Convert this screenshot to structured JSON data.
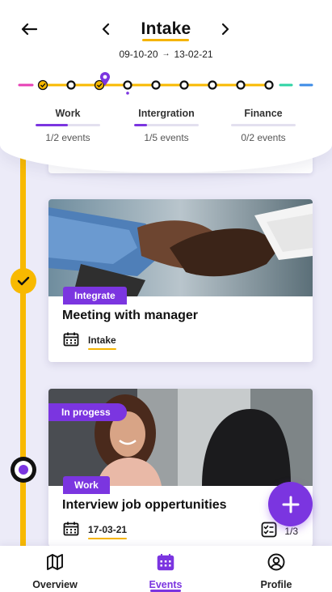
{
  "header": {
    "title": "Intake",
    "date_start": "09-10-20",
    "date_arrow": "→",
    "date_end": "13-02-21"
  },
  "stats": [
    {
      "label": "Work",
      "count": "1/2 events",
      "progress": 0.5
    },
    {
      "label": "Intergration",
      "count": "1/5 events",
      "progress": 0.2
    },
    {
      "label": "Finance",
      "count": "0/2 events",
      "progress": 0
    }
  ],
  "colors": {
    "accent": "#7b35e0",
    "rail": "#f8b900",
    "pink": "#e63fb5",
    "teal": "#2ed3a4",
    "blue": "#3c8be6"
  },
  "cards": [
    {
      "category": "Integrate",
      "title": "Meeting with manager",
      "meta": "Intake",
      "meta_icon": "calendar-icon"
    },
    {
      "status": "In progess",
      "category": "Work",
      "title": "Interview job oppertunities",
      "meta": "17-03-21",
      "meta_icon": "calendar-icon",
      "tasks": "1/3",
      "tasks_icon": "checklist-icon"
    }
  ],
  "nav": {
    "overview": "Overview",
    "events": "Events",
    "profile": "Profile"
  }
}
